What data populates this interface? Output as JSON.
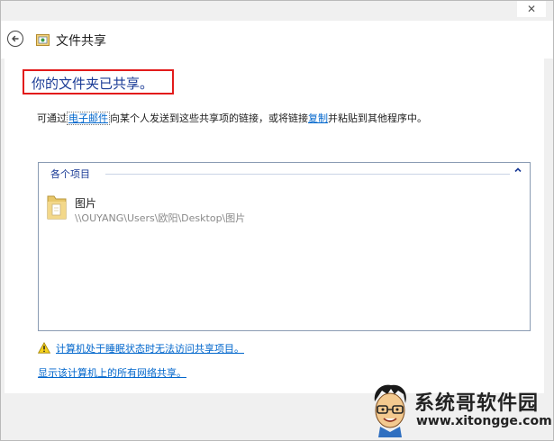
{
  "window": {
    "title": "文件共享",
    "close_glyph": "✕"
  },
  "main": {
    "headline": "你的文件夹已共享。",
    "description": {
      "part1": "可通过",
      "email_link": "电子邮件",
      "part2": "向某个人发送到这些共享项的链接，或将链接",
      "copy_link": "复制",
      "part3": "并粘贴到其他程序中。"
    },
    "items_panel": {
      "header": "各个项目",
      "items": [
        {
          "name": "图片",
          "path": "\\\\OUYANG\\Users\\欧阳\\Desktop\\图片",
          "icon": "folder-icon"
        }
      ]
    },
    "warning_link": "计算机处于睡眠状态时无法访问共享项目。",
    "all_shares_link": "显示该计算机上的所有网络共享。"
  },
  "watermark": {
    "name": "系统哥软件园",
    "url": "www.xitongge.com"
  },
  "colors": {
    "headline": "#1a3b96",
    "link": "#0066cc",
    "highlight_border": "#e21b1b"
  }
}
